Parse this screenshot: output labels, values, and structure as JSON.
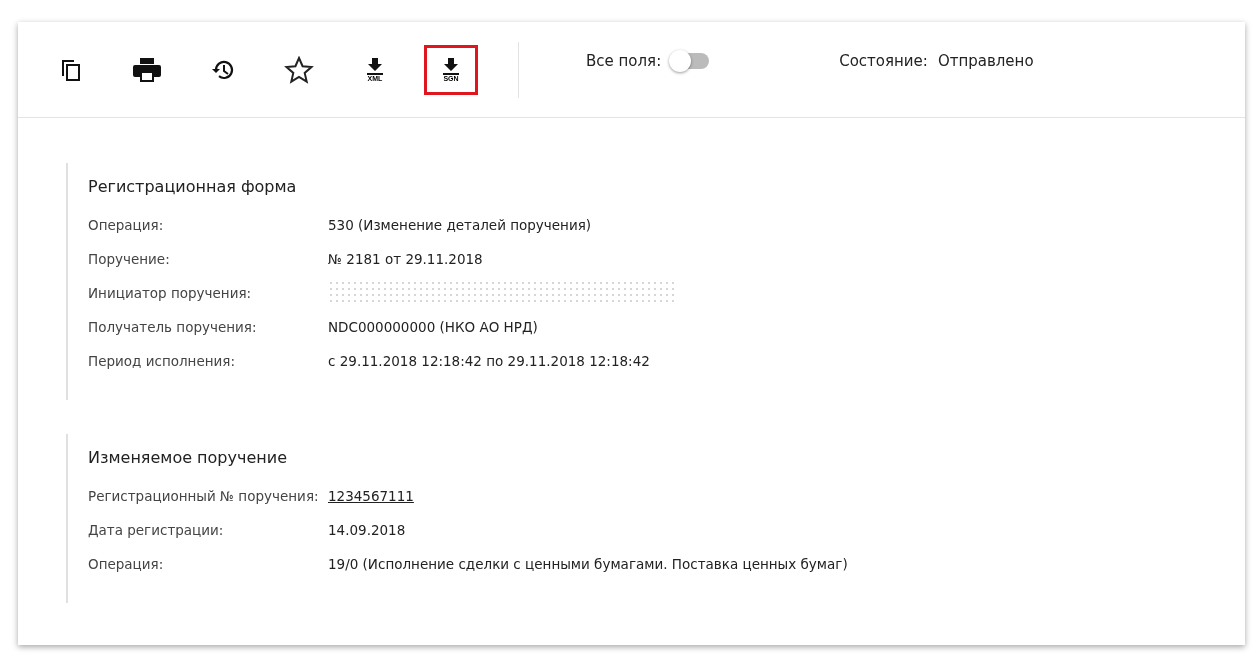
{
  "toolbar": {
    "buttons": [
      {
        "kind": "copy",
        "selected": false
      },
      {
        "kind": "print",
        "selected": false
      },
      {
        "kind": "history",
        "selected": false
      },
      {
        "kind": "star",
        "selected": false
      },
      {
        "kind": "download",
        "caption": "XML",
        "selected": false
      },
      {
        "kind": "download",
        "caption": "SGN",
        "selected": true
      }
    ],
    "all_fields": {
      "label": "Все поля:",
      "on": false
    },
    "status": {
      "label": "Состояние:",
      "value": "Отправлено"
    }
  },
  "sections": [
    {
      "title": "Регистрационная форма",
      "fields": [
        {
          "label": "Операция:",
          "value": "530 (Изменение деталей поручения)"
        },
        {
          "label": "Поручение:",
          "value": "№ 2181 от 29.11.2018"
        },
        {
          "label": "Инициатор поручения:",
          "redacted": true
        },
        {
          "label": "Получатель поручения:",
          "value": "NDC000000000 (НКО АО НРД)"
        },
        {
          "label": "Период исполнения:",
          "value": "с 29.11.2018 12:18:42 по 29.11.2018 12:18:42"
        }
      ]
    },
    {
      "title": "Изменяемое поручение",
      "fields": [
        {
          "label": "Регистрационный № поручения:",
          "value": "1234567111",
          "link": true
        },
        {
          "label": "Дата регистрации:",
          "value": "14.09.2018"
        },
        {
          "label": "Операция:",
          "value": "19/0 (Исполнение сделки с ценными бумагами. Поставка ценных бумаг)"
        }
      ]
    }
  ]
}
